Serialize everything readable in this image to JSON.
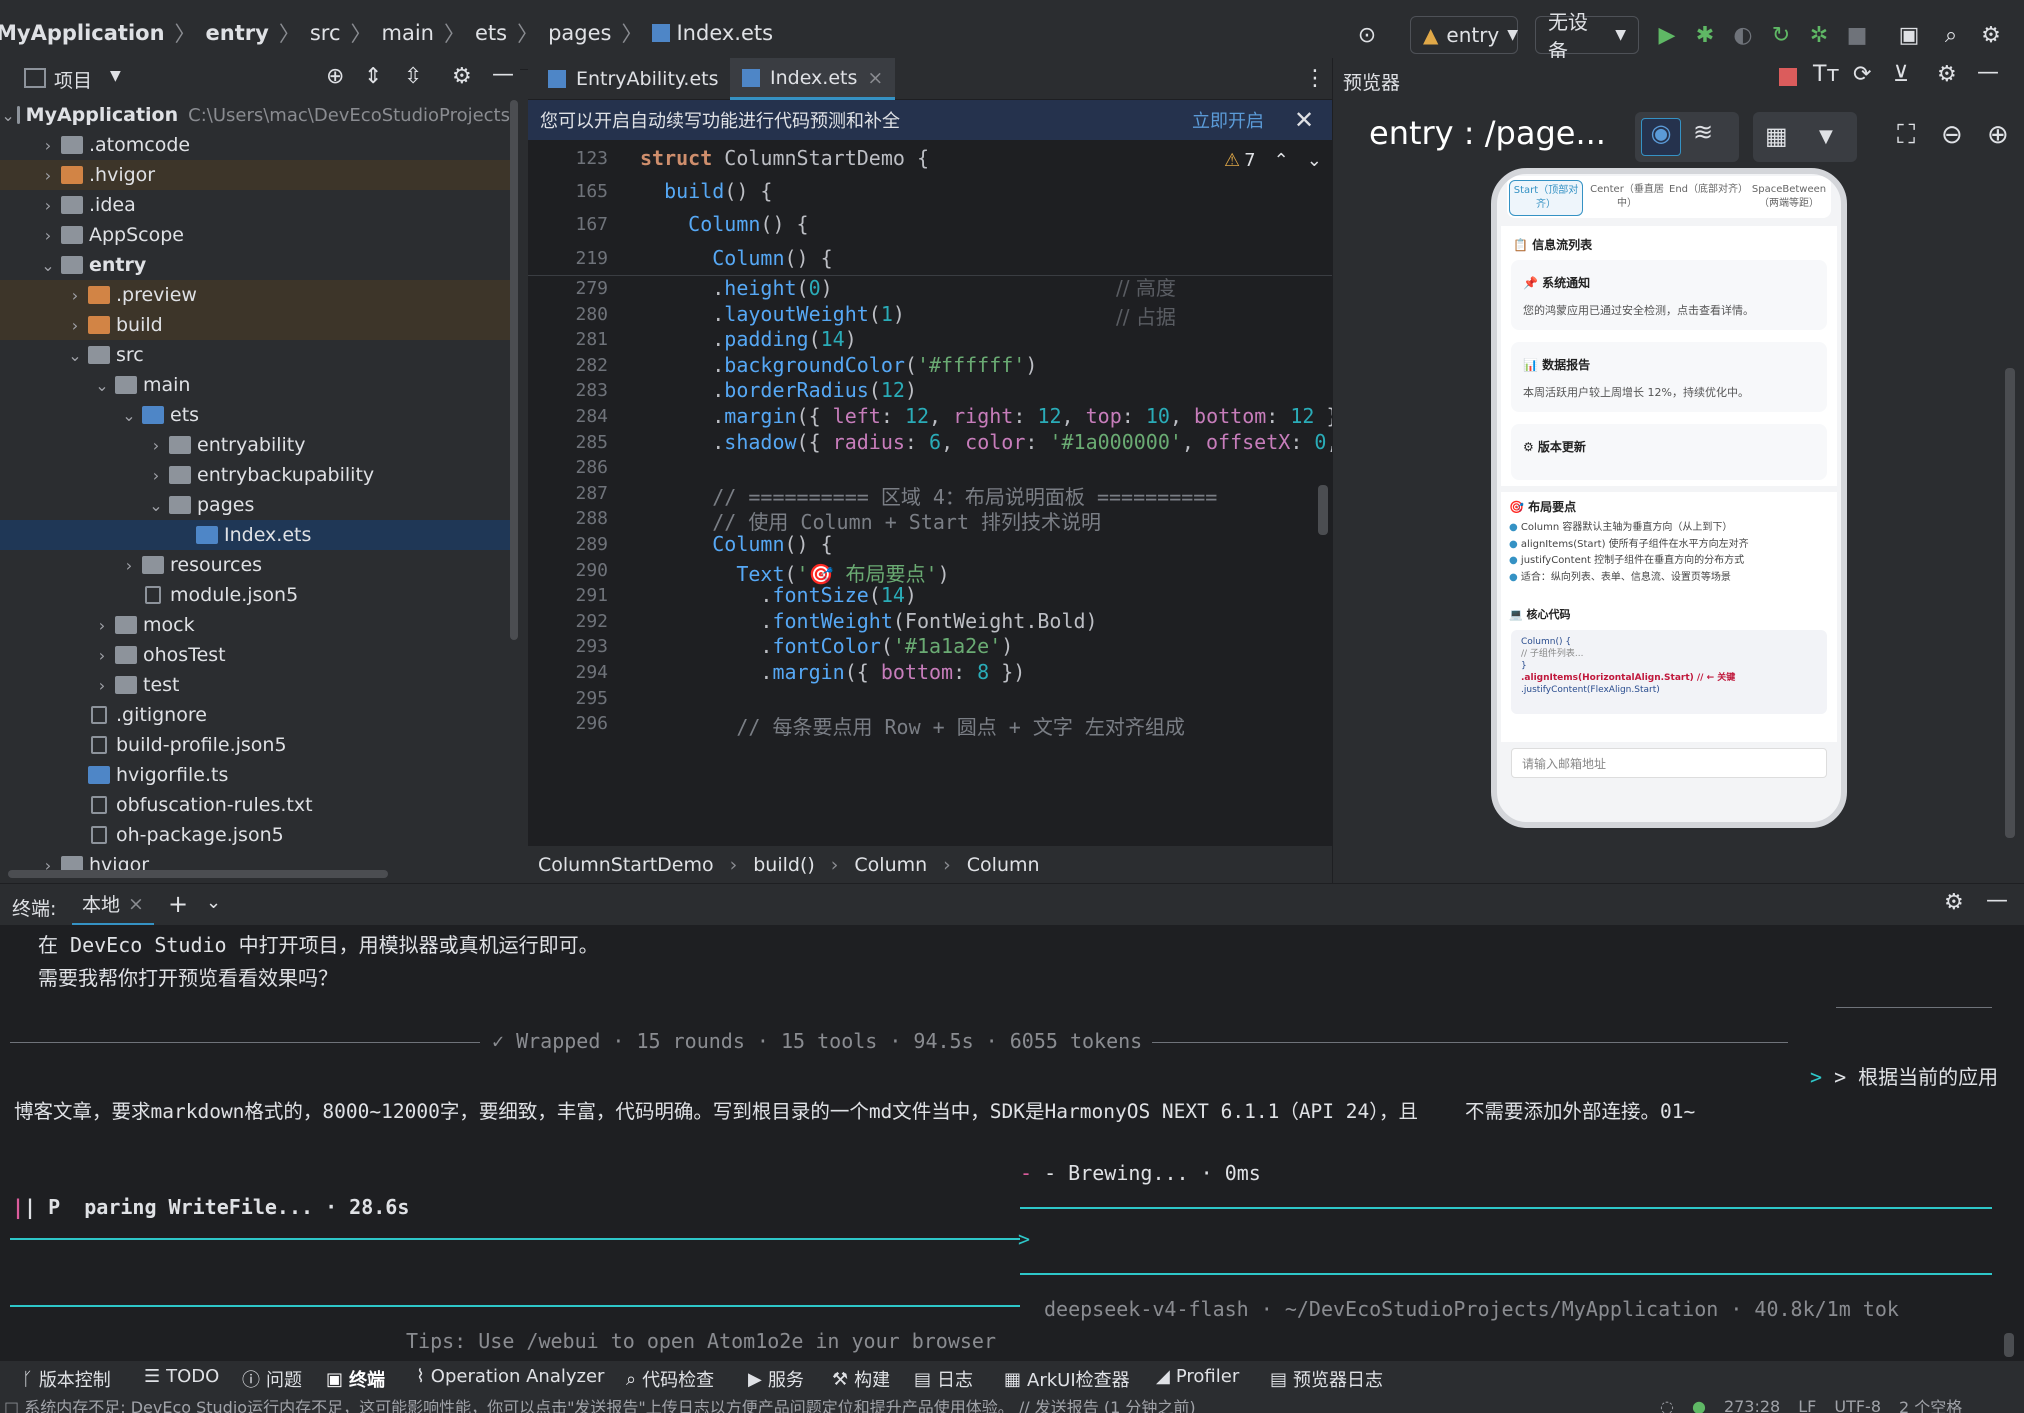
{
  "topbar": {
    "crumbs": [
      "MyApplication",
      "entry",
      "src",
      "main",
      "ets",
      "pages",
      "Index.ets"
    ],
    "run_config": "entry",
    "device": "无设备"
  },
  "project": {
    "title": "项目",
    "tree": [
      {
        "label": "MyApplication",
        "path": "C:\\Users\\mac\\DevEcoStudioProjects",
        "depth": 0,
        "chev": "v",
        "icon": "folder",
        "bold": true
      },
      {
        "label": ".atomcode",
        "depth": 1,
        "chev": ">",
        "icon": "folder"
      },
      {
        "label": ".hvigor",
        "depth": 1,
        "chev": ">",
        "icon": "folder-orange",
        "hl": true
      },
      {
        "label": ".idea",
        "depth": 1,
        "chev": ">",
        "icon": "folder"
      },
      {
        "label": "AppScope",
        "depth": 1,
        "chev": ">",
        "icon": "folder"
      },
      {
        "label": "entry",
        "depth": 1,
        "chev": "v",
        "icon": "folder",
        "bold": true
      },
      {
        "label": ".preview",
        "depth": 2,
        "chev": ">",
        "icon": "folder-orange",
        "hl": true
      },
      {
        "label": "build",
        "depth": 2,
        "chev": ">",
        "icon": "folder-orange",
        "hl": true
      },
      {
        "label": "src",
        "depth": 2,
        "chev": "v",
        "icon": "folder"
      },
      {
        "label": "main",
        "depth": 3,
        "chev": "v",
        "icon": "folder"
      },
      {
        "label": "ets",
        "depth": 4,
        "chev": "v",
        "icon": "folder-blue"
      },
      {
        "label": "entryability",
        "depth": 5,
        "chev": ">",
        "icon": "folder"
      },
      {
        "label": "entrybackupability",
        "depth": 5,
        "chev": ">",
        "icon": "folder"
      },
      {
        "label": "pages",
        "depth": 5,
        "chev": "v",
        "icon": "folder"
      },
      {
        "label": "Index.ets",
        "depth": 6,
        "chev": "",
        "icon": "file-ets",
        "sel": true
      },
      {
        "label": "resources",
        "depth": 4,
        "chev": ">",
        "icon": "folder"
      },
      {
        "label": "module.json5",
        "depth": 4,
        "chev": "",
        "icon": "file"
      },
      {
        "label": "mock",
        "depth": 3,
        "chev": ">",
        "icon": "folder"
      },
      {
        "label": "ohosTest",
        "depth": 3,
        "chev": ">",
        "icon": "folder"
      },
      {
        "label": "test",
        "depth": 3,
        "chev": ">",
        "icon": "folder"
      },
      {
        "label": ".gitignore",
        "depth": 2,
        "chev": "",
        "icon": "file"
      },
      {
        "label": "build-profile.json5",
        "depth": 2,
        "chev": "",
        "icon": "file"
      },
      {
        "label": "hvigorfile.ts",
        "depth": 2,
        "chev": "",
        "icon": "file-ts"
      },
      {
        "label": "obfuscation-rules.txt",
        "depth": 2,
        "chev": "",
        "icon": "file"
      },
      {
        "label": "oh-package.json5",
        "depth": 2,
        "chev": "",
        "icon": "file"
      },
      {
        "label": "hvigor",
        "depth": 1,
        "chev": ">",
        "icon": "folder"
      }
    ]
  },
  "editor": {
    "tabs": [
      "EntryAbility.ets",
      "Index.ets"
    ],
    "notice": "您可以开启自动续写功能进行代码预测和补全",
    "notice_action": "立即开启",
    "warnings": "7",
    "sticky": [
      {
        "ln": "123",
        "text": "struct ColumnStartDemo {"
      },
      {
        "ln": "165",
        "text": "  build() {"
      },
      {
        "ln": "167",
        "text": "    Column() {"
      },
      {
        "ln": "219",
        "text": "      Column() {"
      }
    ],
    "lines": [
      {
        "ln": "279",
        "text": "      .height(0)"
      },
      {
        "ln": "280",
        "text": "      .layoutWeight(1)"
      },
      {
        "ln": "281",
        "text": "      .padding(14)"
      },
      {
        "ln": "282",
        "text": "      .backgroundColor('#ffffff')"
      },
      {
        "ln": "283",
        "text": "      .borderRadius(12)"
      },
      {
        "ln": "284",
        "text": "      .margin({ left: 12, right: 12, top: 10, bottom: 12 }"
      },
      {
        "ln": "285",
        "text": "      .shadow({ radius: 6, color: '#1a000000', offsetX: 0,"
      },
      {
        "ln": "286",
        "text": ""
      },
      {
        "ln": "287",
        "text": "      // ========== 区域 4：布局说明面板 =========="
      },
      {
        "ln": "288",
        "text": "      // 使用 Column + Start 排列技术说明"
      },
      {
        "ln": "289",
        "text": "      Column() {"
      },
      {
        "ln": "290",
        "text": "        Text('🎯 布局要点')"
      },
      {
        "ln": "291",
        "text": "          .fontSize(14)"
      },
      {
        "ln": "292",
        "text": "          .fontWeight(FontWeight.Bold)"
      },
      {
        "ln": "293",
        "text": "          .fontColor('#1a1a2e')"
      },
      {
        "ln": "294",
        "text": "          .margin({ bottom: 8 })"
      },
      {
        "ln": "295",
        "text": ""
      },
      {
        "ln": "296",
        "text": "        // 每条要点用 Row + 圆点 + 文字 左对齐组成"
      }
    ],
    "breadcrumb": [
      "ColumnStartDemo",
      "build()",
      "Column",
      "Column"
    ]
  },
  "preview": {
    "title": "预览器",
    "route": "entry : /page...",
    "phone": {
      "seg": [
        "Start（顶部对齐）",
        "Center（垂直居中）",
        "End（底部对齐）",
        "SpaceBetween（两端等距）"
      ],
      "feed_title": "📋 信息流列表",
      "cards": [
        {
          "title": "📌 系统通知",
          "desc": "您的鸿蒙应用已通过安全检测，点击查看详情。"
        },
        {
          "title": "📊 数据报告",
          "desc": "本周活跃用户较上周增长 12%，持续优化中。"
        },
        {
          "title": "⚙ 版本更新",
          "desc": ""
        }
      ],
      "layout_title": "🎯 布局要点",
      "bullets": [
        "Column 容器默认主轴为垂直方向（从上到下）",
        "alignItems(Start) 使所有子组件在水平方向左对齐",
        "justifyContent 控制子组件在垂直方向的分布方式",
        "适合：纵向列表、表单、信息流、设置页等场景"
      ],
      "code_title": "💻 核心代码",
      "code": [
        "Column() {",
        "  // 子组件列表...",
        "}",
        ".alignItems(HorizontalAlign.Start) // ← 关键",
        ".justifyContent(FlexAlign.Start)"
      ],
      "input_placeholder": "请输入邮箱地址"
    }
  },
  "terminal": {
    "label": "终端:",
    "tab": "本地",
    "lines": {
      "l1": "在 DevEco Studio 中打开项目，用模拟器或真机运行即可。",
      "l2": "需要我帮你打开预览看看效果吗？",
      "wrapped": "✓ Wrapped · 15 rounds · 15 tools · 94.5s · 6055 tokens",
      "prompt_right": "> 根据当前的应用",
      "request": "博客文章，要求markdown格式的，8000~12000字，要细致，丰富，代码明确。写到根目录的一个md文件当中，SDK是HarmonyOS NEXT 6.1.1（API 24），且    不需要添加外部连接。01~",
      "brewing": "- Brewing... · 0ms",
      "preparing": "| P  paring WriteFile... · 28.6s",
      "arrow": ">",
      "model": "deepseek-v4-flash · ~/DevEcoStudioProjects/MyApplication · 40.8k/1m tok",
      "tips": "Tips: Use /webui to open Atom1o2e in your browser"
    }
  },
  "tools": [
    "版本控制",
    "TODO",
    "问题",
    "终端",
    "Operation Analyzer",
    "代码检查",
    "服务",
    "构建",
    "日志",
    "ArkUI检查器",
    "Profiler",
    "预览器日志"
  ],
  "status": {
    "message": "系统内存不足: DevEco Studio运行内存不足，这可能影响性能，你可以点击\"发送报告\"上传日志以方便产品问题定位和提升产品使用体验。 // 发送报告 (1 分钟之前)",
    "position": "273:28",
    "line_sep": "LF",
    "encoding": "UTF-8",
    "indent": "2 个空格"
  },
  "colors": {
    "accent": "#3592c4",
    "cyan": "#2ec7c9",
    "run_green": "#5fb865",
    "stop_red": "#db5c5c"
  }
}
